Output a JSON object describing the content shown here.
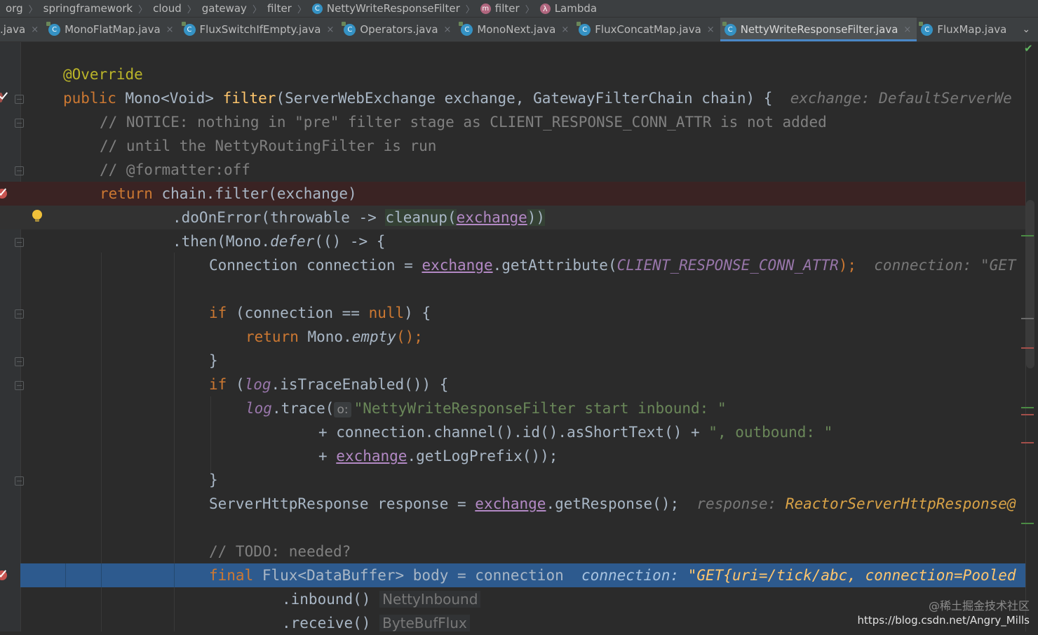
{
  "breadcrumb": {
    "items": [
      "org",
      "springframework",
      "cloud",
      "gateway",
      "filter",
      "NettyWriteResponseFilter",
      "filter",
      "Lambda"
    ],
    "separator": "〉"
  },
  "tabs": [
    {
      "label": ".java",
      "close": "×"
    },
    {
      "label": "MonoFlatMap.java",
      "close": "×"
    },
    {
      "label": "FluxSwitchIfEmpty.java",
      "close": "×"
    },
    {
      "label": "Operators.java",
      "close": "×"
    },
    {
      "label": "MonoNext.java",
      "close": "×"
    },
    {
      "label": "FluxConcatMap.java",
      "close": "×"
    },
    {
      "label": "NettyWriteResponseFilter.java",
      "close": "×",
      "active": true
    },
    {
      "label": "FluxMap.java"
    }
  ],
  "icons": {
    "class_letter": "C",
    "method_letter": "m",
    "lambda_letter": "λ",
    "tab_overflow": "⌄",
    "status_ok": "✔"
  },
  "code": {
    "l1": {
      "ann": "@Override"
    },
    "l2": {
      "kw": "public",
      "ret": " Mono<Void> ",
      "fn": "filter",
      "sig": "(ServerWebExchange exchange, GatewayFilterChain chain) {",
      "hint": "exchange: DefaultServerWe"
    },
    "l3": {
      "cm": "// NOTICE: nothing in \"pre\" filter stage as CLIENT_RESPONSE_CONN_ATTR is not added"
    },
    "l4": {
      "cm": "// until the NettyRoutingFilter is run"
    },
    "l5": {
      "cm": "// @formatter:off"
    },
    "l6": {
      "kw": "return",
      "rest": " chain.filter(exchange)"
    },
    "l7": {
      "a": ".doOnError(throwable -> ",
      "fn": "cleanup",
      "p1": "(",
      "param": "exchange",
      "p2": "))"
    },
    "l8": {
      "a": ".then(Mono.",
      "it": "defer",
      "b": "(() -> {"
    },
    "l9": {
      "a": "Connection connection = ",
      "param": "exchange",
      "b": ".getAttribute(",
      "cst": "CLIENT_RESPONSE_CONN_ATTR",
      "c": ");",
      "hint": "connection: \"GET"
    },
    "l10": {
      "kw": "if",
      "a": " (connection == ",
      "kw2": "null",
      "b": ") {"
    },
    "l11": {
      "kw": "return",
      "a": " Mono.",
      "it": "empty",
      "b": "();"
    },
    "l12": {
      "a": "}"
    },
    "l13": {
      "kw": "if",
      "a": " (",
      "log": "log",
      "b": ".isTraceEnabled()) {"
    },
    "l14": {
      "log": "log",
      "a": ".trace(",
      "chip": "o:",
      "str": "\"NettyWriteResponseFilter start inbound: \""
    },
    "l15": {
      "a": "+ connection.channel().id().asShortText() + ",
      "str": "\", outbound: \""
    },
    "l16": {
      "a": "+ ",
      "param": "exchange",
      "b": ".getLogPrefix());"
    },
    "l17": {
      "a": "}"
    },
    "l18": {
      "a": "ServerHttpResponse response = ",
      "param": "exchange",
      "b": ".getResponse();",
      "hint": "response: ",
      "hint_type": "ReactorServerHttpResponse@"
    },
    "l19": {
      "cm": "// TODO: needed?"
    },
    "l20": {
      "kw": "final",
      "a": " Flux<DataBuffer> body = connection",
      "hint": "connection: ",
      "hint_val": "\"GET{uri=/tick/abc, connection=Pooled"
    },
    "l21": {
      "a": ".inbound()",
      "inlay": "NettyInbound"
    },
    "l22": {
      "a": ".receive()",
      "inlay": "ByteBufFlux"
    }
  },
  "watermark": {
    "line1": "@稀土掘金技术社区",
    "line2": "https://blog.csdn.net/Angry_Mills"
  }
}
